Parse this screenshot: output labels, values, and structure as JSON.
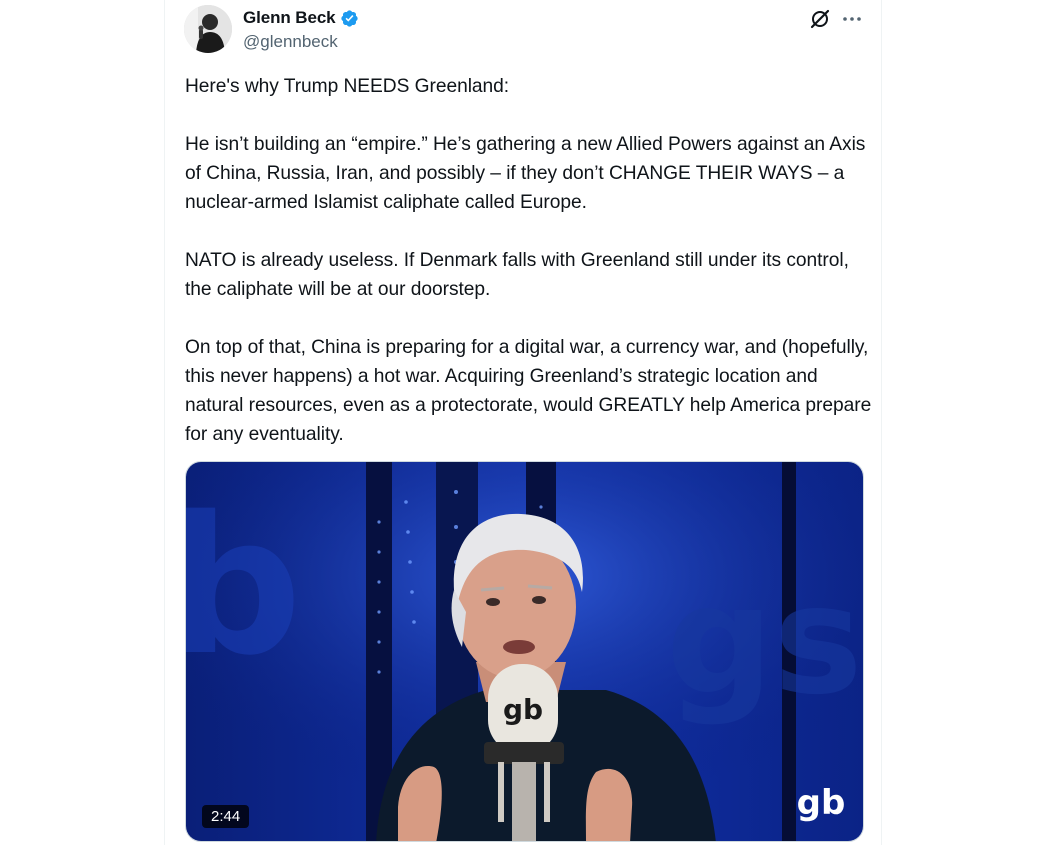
{
  "tweet": {
    "author": {
      "name": "Glenn Beck",
      "handle": "@glennbeck",
      "verified": true
    },
    "text": "Here's why Trump NEEDS Greenland:\n\nHe isn’t building an “empire.” He’s gathering a new Allied Powers against an Axis of China, Russia, Iran, and possibly – if they don’t CHANGE THEIR WAYS – a nuclear-armed Islamist caliphate called Europe.\n\nNATO is already useless. If Denmark falls with Greenland still under its control, the caliphate will be at our doorstep.\n\nOn top of that, China is preparing for a digital war, a currency war, and (hopefully, this never happens) a hot war. Acquiring Greenland’s strategic location and natural resources, even as a protectorate, would GREATLY help America prepare for any eventuality.",
    "media": {
      "type": "video",
      "duration": "2:44",
      "watermark": "gb",
      "mic_logo": "gb"
    },
    "icons": {
      "grok": "grok-icon",
      "more": "more-icon",
      "verified": "verified-badge-icon"
    }
  },
  "colors": {
    "text_primary": "#0f1419",
    "text_secondary": "#536471",
    "verified_blue": "#1d9bf0",
    "border": "#eff3f4"
  }
}
